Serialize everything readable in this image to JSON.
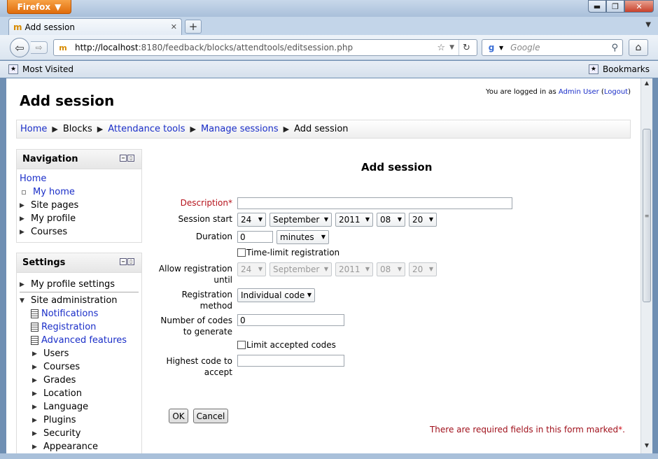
{
  "browser": {
    "app_button": "Firefox",
    "tab_title": "Add session",
    "url_host": "http://localhost",
    "url_rest": ":8180/feedback/blocks/attendtools/editsession.php",
    "search_placeholder": "Google",
    "bookmarks_left": "Most Visited",
    "bookmarks_right": "Bookmarks"
  },
  "header": {
    "title": "Add session",
    "login_prefix": "You are logged in as ",
    "login_user": "Admin User",
    "logout": "Logout"
  },
  "breadcrumb": {
    "items": [
      "Home",
      "Blocks",
      "Attendance tools",
      "Manage sessions",
      "Add session"
    ]
  },
  "navigation": {
    "title": "Navigation",
    "items": [
      "Home",
      "My home",
      "Site pages",
      "My profile",
      "Courses"
    ]
  },
  "settings": {
    "title": "Settings",
    "items": [
      "My profile settings",
      "Site administration",
      "Notifications",
      "Registration",
      "Advanced features",
      "Users",
      "Courses",
      "Grades",
      "Location",
      "Language",
      "Plugins",
      "Security",
      "Appearance"
    ]
  },
  "form": {
    "heading": "Add session",
    "description_label": "Description",
    "required_mark": "*",
    "description_value": "",
    "session_start_label": "Session start",
    "session_start": {
      "day": "24",
      "month": "September",
      "year": "2011",
      "hour": "08",
      "minute": "20"
    },
    "duration_label": "Duration",
    "duration_value": "0",
    "duration_unit": "minutes",
    "time_limit_label": "Time-limit registration",
    "allow_until_label1": "Allow registration",
    "allow_until_label2": "until",
    "allow_until": {
      "day": "24",
      "month": "September",
      "year": "2011",
      "hour": "08",
      "minute": "20"
    },
    "reg_method_label1": "Registration",
    "reg_method_label2": "method",
    "reg_method_value": "Individual code",
    "num_codes_label1": "Number of codes",
    "num_codes_label2": "to generate",
    "num_codes_value": "0",
    "limit_codes_label": "Limit accepted codes",
    "highest_code_label1": "Highest code to",
    "highest_code_label2": "accept",
    "highest_code_value": "",
    "ok": "OK",
    "cancel": "Cancel",
    "required_note": "There are required fields in this form marked",
    "required_note_end": "."
  }
}
